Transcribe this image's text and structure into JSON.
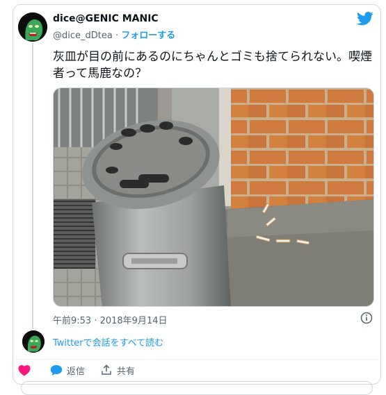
{
  "user": {
    "display_name": "dice@GENIC MANIC",
    "handle": "@dice_dDtea",
    "separator": "·",
    "follow_label": "フォローする"
  },
  "tweet": {
    "text": "灰皿が目の前にあるのにちゃんとゴミも捨てられない。喫煙者って馬鹿なの？",
    "timestamp": "午前9:53 · 2018年9月14日"
  },
  "conversation": {
    "link_label": "Twitterで会話をすべて読む"
  },
  "actions": {
    "reply_label": "返信",
    "share_label": "共有"
  },
  "colors": {
    "accent": "#1d9bf0",
    "like": "#f91880",
    "text": "#0f1419",
    "secondary": "#536471"
  },
  "icons": [
    "twitter-bird-icon",
    "info-icon",
    "heart-icon",
    "reply-bubble-icon",
    "share-icon"
  ]
}
